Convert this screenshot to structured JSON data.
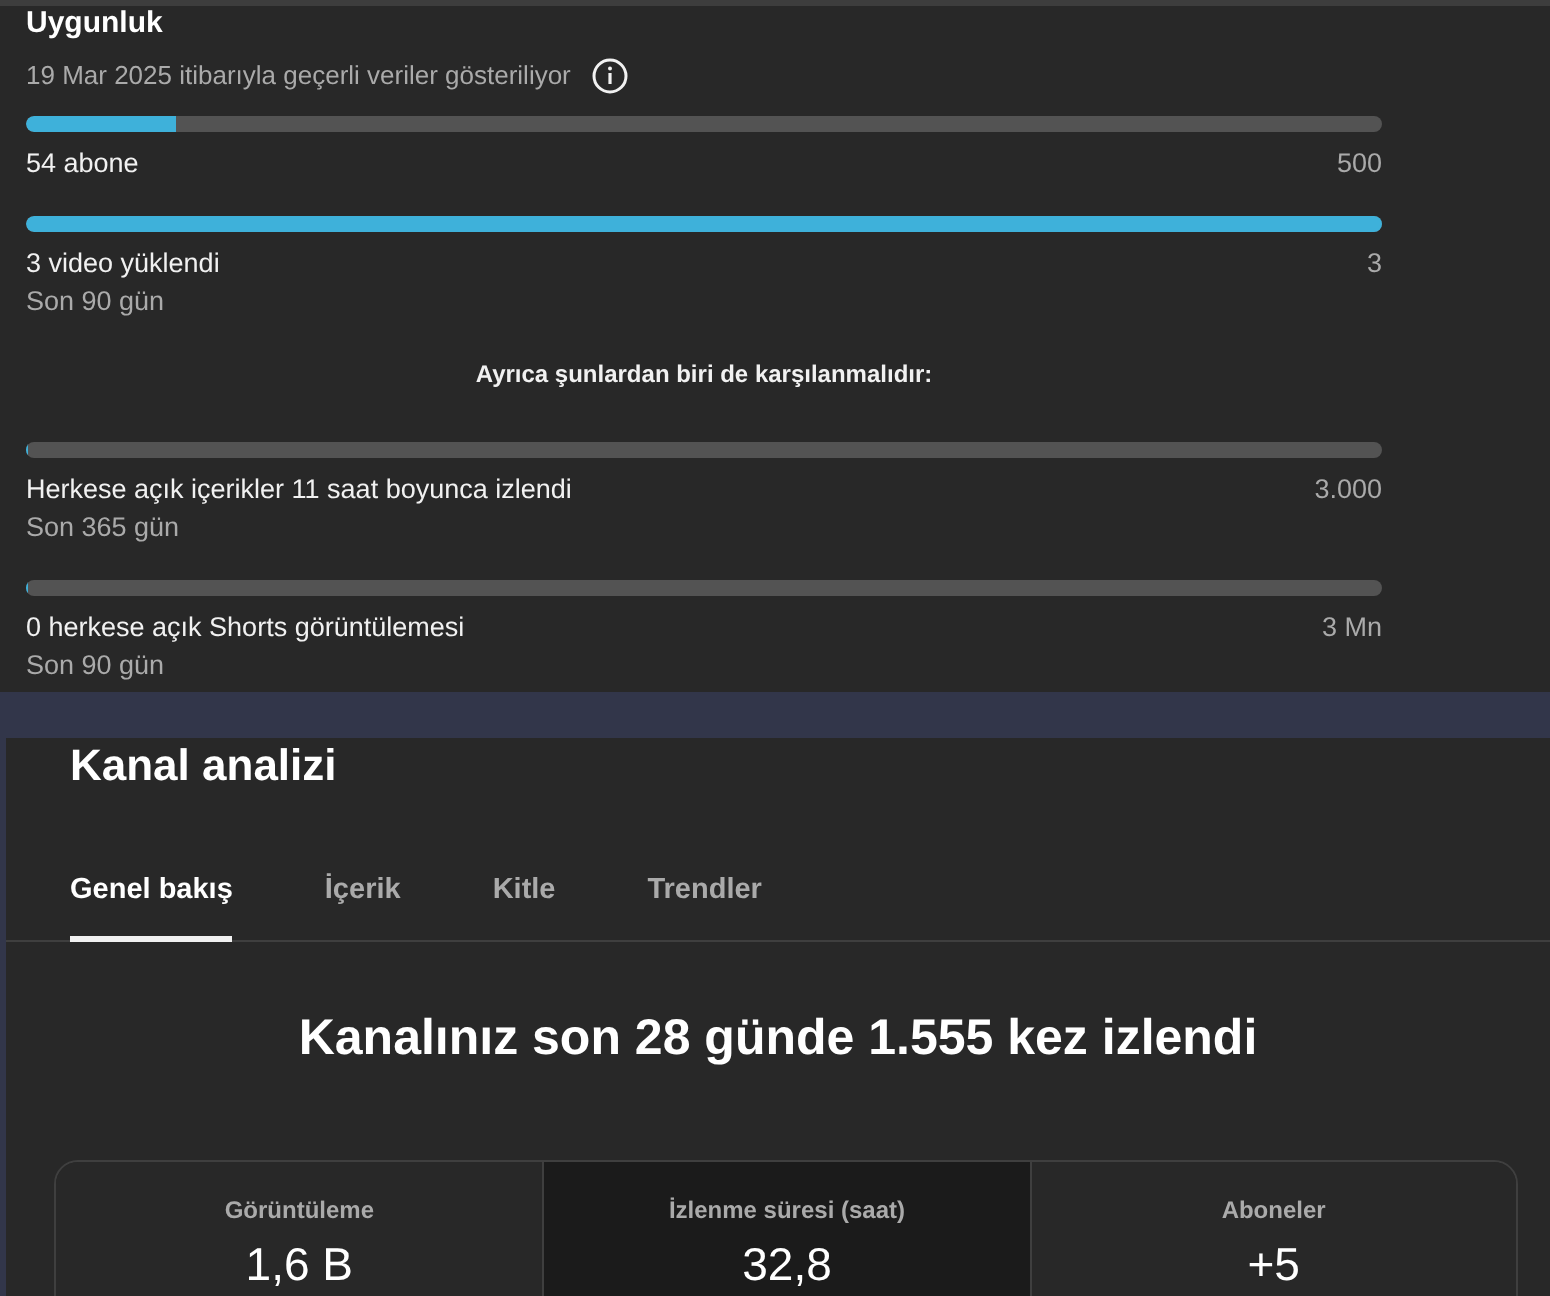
{
  "eligibility": {
    "title": "Uygunluk",
    "as_of": "19 Mar 2025 itibarıyla geçerli veriler gösteriliyor",
    "requirements": [
      {
        "label": "54 abone",
        "target": "500",
        "level": 0.11
      },
      {
        "label": "3 video yüklendi",
        "target": "3",
        "period": "Son 90 gün",
        "level": 1
      }
    ],
    "note": "Ayrıca şunlardan biri de karşılanmalıdır:",
    "alternatives": [
      {
        "label": "Herkese açık içerikler 11 saat boyunca izlendi",
        "target": "3.000",
        "period": "Son 365 gün",
        "level": 0
      },
      {
        "label": "0 herkese açık Shorts görüntülemesi",
        "target": "3 Mn",
        "period": "Son 90 gün",
        "level": 0
      }
    ]
  },
  "analytics": {
    "title": "Kanal analizi",
    "tabs": [
      {
        "label": "Genel bakış",
        "selected": true
      },
      {
        "label": "İçerik",
        "selected": false
      },
      {
        "label": "Kitle",
        "selected": false
      },
      {
        "label": "Trendler",
        "selected": false
      }
    ],
    "headline": "Kanalınız son 28 günde 1.555 kez izlendi",
    "metrics": [
      {
        "label": "Görüntüleme",
        "value": "1,6 B",
        "selected": false
      },
      {
        "label": "İzlenme süresi (saat)",
        "value": "32,8",
        "selected": true
      },
      {
        "label": "Aboneler",
        "value": "+5",
        "selected": false
      }
    ]
  }
}
